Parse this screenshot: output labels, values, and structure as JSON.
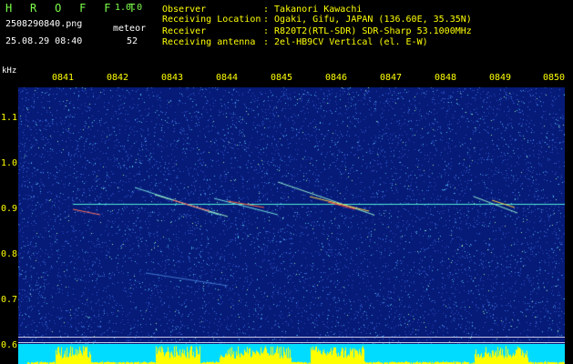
{
  "header": {
    "app_name": "H R O F F T",
    "version": "1.0.0",
    "file_name": "2508290840.png",
    "datetime": "25.08.29 08:40",
    "meteor_label": "meteor",
    "meteor_count": "52",
    "info": [
      {
        "key": "Observer",
        "value": ": Takanori Kawachi"
      },
      {
        "key": "Receiving Location",
        "value": ": Ogaki, Gifu, JAPAN (136.60E, 35.35N)"
      },
      {
        "key": "Receiver",
        "value": ": R820T2(RTL-SDR) SDR-Sharp 53.1000MHz"
      },
      {
        "key": "Receiving antenna",
        "value": ": 2el-HB9CV Vertical (el. E-W)"
      }
    ]
  },
  "axis": {
    "y_unit": "kHz",
    "x_ticks": [
      "0841",
      "0842",
      "0843",
      "0844",
      "0845",
      "0846",
      "0847",
      "0848",
      "0849",
      "0850"
    ],
    "y_ticks": [
      "1.1",
      "1.0",
      "0.9",
      "0.8",
      "0.7",
      "0.6"
    ]
  },
  "colors": {
    "background": "#000000",
    "plot_background": "#061a78",
    "label_yellow": "#ffff00",
    "brand_green": "#7cff4a",
    "carrier_line": "#4ff0d8",
    "activity_bars": "#ffff00",
    "activity_base": "#00dcff"
  }
}
